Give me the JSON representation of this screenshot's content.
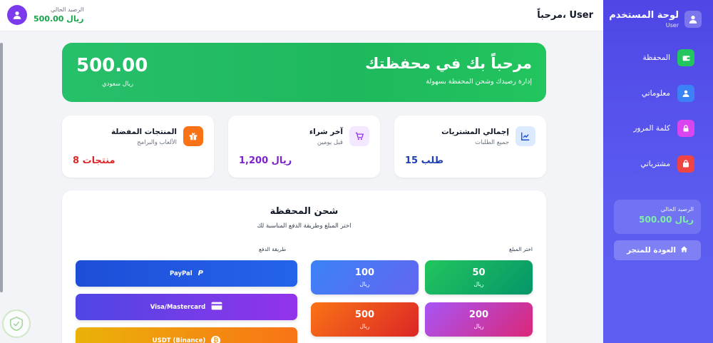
{
  "topbar": {
    "greeting": "مرحباً، User",
    "balance_label": "الرصيد الحالي",
    "balance_value": "500.00 ريال"
  },
  "sidebar": {
    "title": "لوحة المستخدم",
    "subtitle": "User",
    "items": [
      {
        "label": "المحفظة",
        "icon": "wallet-icon",
        "color": "#22c55e"
      },
      {
        "label": "معلوماتي",
        "icon": "user-icon",
        "color": "#3b82f6"
      },
      {
        "label": "كلمة المرور",
        "icon": "lock-icon",
        "color": "#d946ef"
      },
      {
        "label": "مشترياتي",
        "icon": "bag-icon",
        "color": "#ef4444"
      }
    ],
    "balance_label": "الرصيد الحالي",
    "balance_value": "500.00 ريال",
    "back_label": "العودة للمتجر"
  },
  "hero": {
    "title": "مرحباً بك في محفظتك",
    "subtitle": "إدارة رصيدك وشحن المحفظة بسهولة",
    "amount": "500.00",
    "currency": "ريال سعودي"
  },
  "stats": [
    {
      "title": "إجمالي المشتريات",
      "subtitle": "جميع الطلبات",
      "value": "15 طلب",
      "icon": "chart-icon",
      "value_color": "#1e40af"
    },
    {
      "title": "آخر شراء",
      "subtitle": "قبل يومين",
      "value": "1,200 ريال",
      "icon": "cart-icon",
      "value_color": "#7e22ce"
    },
    {
      "title": "المنتجات المفضلة",
      "subtitle": "الألعاب والبرامج",
      "value": "8 منتجات",
      "icon": "gift-icon",
      "value_color": "#dc2626"
    }
  ],
  "charge": {
    "title": "شحن المحفظة",
    "subtitle": "اختر المبلغ وطريقة الدفع المناسبة لك",
    "amount_label": "اختر المبلغ",
    "payment_label": "طريقة الدفع",
    "amounts": [
      {
        "value": "50",
        "currency": "ريال"
      },
      {
        "value": "100",
        "currency": "ريال"
      },
      {
        "value": "200",
        "currency": "ريال"
      },
      {
        "value": "500",
        "currency": "ريال"
      }
    ],
    "methods": [
      {
        "label": "PayPal",
        "icon": "paypal-icon"
      },
      {
        "label": "Visa/Mastercard",
        "icon": "credit-card-icon"
      },
      {
        "label": "USDT (Binance)",
        "icon": "bitcoin-icon"
      }
    ]
  }
}
